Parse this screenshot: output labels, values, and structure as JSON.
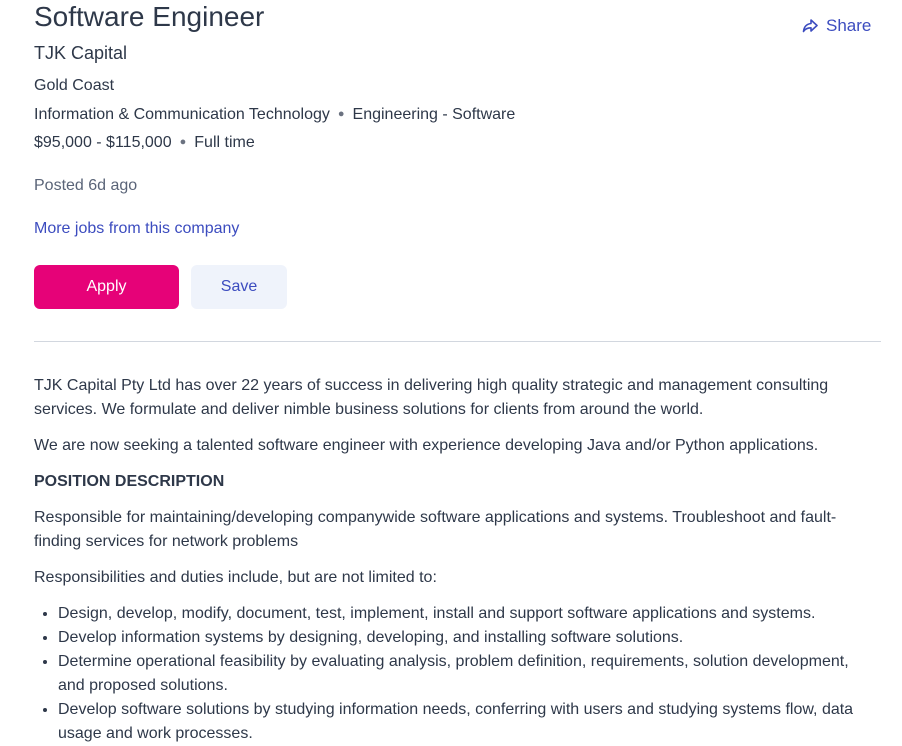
{
  "job": {
    "title": "Software Engineer",
    "company": "TJK Capital",
    "location": "Gold Coast",
    "classification": "Information & Communication Technology",
    "subclassification": "Engineering - Software",
    "salary": "$95,000 - $115,000",
    "work_type": "Full time",
    "posted": "Posted 6d ago",
    "more_jobs_link": "More jobs from this company"
  },
  "actions": {
    "share_label": "Share",
    "share_icon": "share-arrow-icon",
    "apply_label": "Apply",
    "save_label": "Save"
  },
  "colors": {
    "apply_bg": "#e60278",
    "link": "#3c4cbf",
    "save_bg": "#eff3fb",
    "text": "#2e3849"
  },
  "description": {
    "intro_1": "TJK Capital Pty Ltd has over 22 years of success in delivering high quality strategic and management consulting services. We formulate and deliver nimble business solutions for clients from around the world.",
    "intro_2": "We are now seeking a talented software engineer with experience developing Java and/or Python applications.",
    "heading": "POSITION DESCRIPTION",
    "summary": "Responsible for maintaining/developing companywide software applications and systems. Troubleshoot and fault-finding services for network problems",
    "duties_intro": "Responsibilities and duties include, but are not limited to:",
    "duties": [
      "Design, develop, modify, document, test, implement, install and support software applications and systems.",
      "Develop information systems by designing, developing, and installing software solutions.",
      "Determine operational feasibility by evaluating analysis, problem definition, requirements, solution development, and proposed solutions.",
      "Develop software solutions by studying information needs, conferring with users and studying systems flow, data usage and work processes."
    ]
  }
}
